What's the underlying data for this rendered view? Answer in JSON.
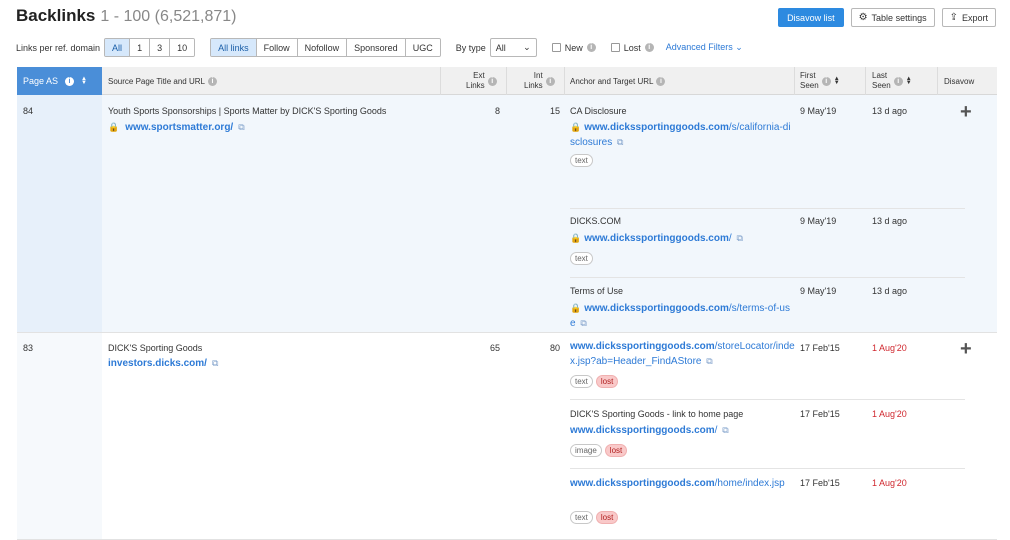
{
  "header": {
    "title": "Backlinks",
    "range": "1 - 100 (6,521,871)"
  },
  "top_actions": {
    "disavow_list": "Disavow list",
    "table_settings": "Table settings",
    "export": "Export"
  },
  "filters": {
    "links_per_domain_label": "Links per ref. domain",
    "links_per_domain": [
      "All",
      "1",
      "3",
      "10"
    ],
    "link_types": [
      "All links",
      "Follow",
      "Nofollow",
      "Sponsored",
      "UGC"
    ],
    "by_type_label": "By type",
    "by_type_value": "All",
    "new_label": "New",
    "lost_label": "Lost",
    "advanced_filters": "Advanced Filters"
  },
  "columns": {
    "page_as": "Page AS",
    "source": "Source Page Title and URL",
    "ext_links_1": "Ext",
    "ext_links_2": "Links",
    "int_links_1": "Int",
    "int_links_2": "Links",
    "anchor": "Anchor and Target URL",
    "first_seen_1": "First",
    "first_seen_2": "Seen",
    "last_seen_1": "Last",
    "last_seen_2": "Seen",
    "disavow": "Disavow"
  },
  "rows": [
    {
      "page_as": "84",
      "source_title": "Youth Sports Sponsorships | Sports Matter by DICK'S Sporting Goods",
      "source_url": "www.sportsmatter.org/",
      "ext_links": "8",
      "int_links": "15",
      "anchors": [
        {
          "text": "CA Disclosure",
          "url_domain": "www.dickssportinggoods.com",
          "url_path": "/s/california-disclosures",
          "tags": [
            "text"
          ],
          "first_seen": "9 May'19",
          "last_seen": "13 d ago"
        },
        {
          "text": "DICKS.COM",
          "url_domain": "www.dickssportinggoods.com",
          "url_path": "/",
          "tags": [
            "text"
          ],
          "first_seen": "9 May'19",
          "last_seen": "13 d ago"
        },
        {
          "text": "Terms of Use",
          "url_domain": "www.dickssportinggoods.com",
          "url_path": "/s/terms-of-use",
          "tags": [
            "text"
          ],
          "first_seen": "9 May'19",
          "last_seen": "13 d ago"
        }
      ]
    },
    {
      "page_as": "83",
      "source_title": "DICK'S Sporting Goods",
      "source_url": "investors.dicks.com/",
      "ext_links": "65",
      "int_links": "80",
      "anchors": [
        {
          "text": "",
          "url_domain": "www.dickssportinggoods.com",
          "url_path": "/storeLocator/index.jsp?ab=Header_FindAStore",
          "tags": [
            "text",
            "lost"
          ],
          "first_seen": "17 Feb'15",
          "last_seen": "1 Aug'20"
        },
        {
          "text": "DICK'S Sporting Goods - link to home page",
          "url_domain": "www.dickssportinggoods.com",
          "url_path": "/",
          "tags": [
            "image",
            "lost"
          ],
          "first_seen": "17 Feb'15",
          "last_seen": "1 Aug'20"
        },
        {
          "text": "",
          "url_domain": "www.dickssportinggoods.com",
          "url_path": "/home/index.jsp",
          "tags": [
            "text",
            "lost"
          ],
          "first_seen": "17 Feb'15",
          "last_seen": "1 Aug'20"
        }
      ]
    }
  ],
  "colors": {
    "primary": "#2d8ae0",
    "lost": "#d0282f",
    "link": "#2d7ad6"
  }
}
